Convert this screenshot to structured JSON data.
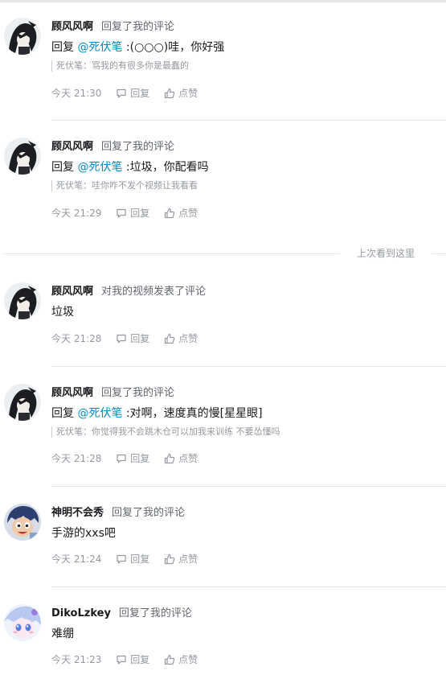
{
  "messages": [
    {
      "avatar": "anime-character-dark-hair",
      "username": "顾风风啊",
      "action": "回复了我的评论",
      "reply_prefix": "回复",
      "mention": "@死伏笔",
      "text": ":(○○○)哇，你好强",
      "quote": "死伏笔：骂我的有很多你是最蠢的",
      "time": "今天 21:30",
      "reply_label": "回复",
      "like_label": "点赞"
    },
    {
      "avatar": "anime-character-dark-hair",
      "username": "顾风风啊",
      "action": "回复了我的评论",
      "reply_prefix": "回复",
      "mention": "@死伏笔",
      "text": ":垃圾，你配看吗",
      "quote": "死伏笔：哇你咋不发个视频让我看看",
      "time": "今天 21:29",
      "reply_label": "回复",
      "like_label": "点赞"
    },
    {
      "avatar": "anime-character-dark-hair",
      "username": "顾风风啊",
      "action": "对我的视频发表了评论",
      "text": "垃圾",
      "time": "今天 21:28",
      "reply_label": "回复",
      "like_label": "点赞"
    },
    {
      "avatar": "anime-character-dark-hair",
      "username": "顾风风啊",
      "action": "回复了我的评论",
      "reply_prefix": "回复",
      "mention": "@死伏笔",
      "text": ":对啊，速度真的慢[星星眼]",
      "quote": "死伏笔：你觉得我不会跳木仓可以加我来训练 不要怂懂吗",
      "time": "今天 21:28",
      "reply_label": "回复",
      "like_label": "点赞"
    },
    {
      "avatar": "cartoon-character-blue-hair",
      "username": "神明不会秀",
      "action": "回复了我的评论",
      "text": "手游的xxs吧",
      "time": "今天 21:24",
      "reply_label": "回复",
      "like_label": "点赞"
    },
    {
      "avatar": "anime-character-light-blue",
      "username": "DikoLzkey",
      "action": "回复了我的评论",
      "text": "难绷",
      "time": "今天 21:23",
      "reply_label": "回复",
      "like_label": "点赞"
    }
  ],
  "last_seen_label": "上次看到这里",
  "colors": {
    "mention": "#008ac5",
    "muted": "#9499a0",
    "divider": "#e3e5e7"
  }
}
